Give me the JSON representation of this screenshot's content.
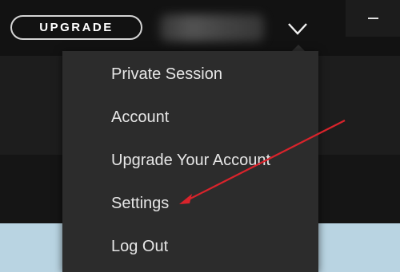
{
  "header": {
    "upgrade_label": "UPGRADE"
  },
  "icons": {
    "profile_menu": "chevron-down-icon",
    "minimize": "minimize-icon"
  },
  "menu": {
    "items": [
      {
        "label": "Private Session"
      },
      {
        "label": "Account"
      },
      {
        "label": "Upgrade Your Account"
      },
      {
        "label": "Settings"
      },
      {
        "label": "Log Out"
      }
    ]
  },
  "annotation": {
    "arrow_color": "#d9232b",
    "points_to": "Settings"
  },
  "colors": {
    "background": "#121212",
    "menu_background": "#2c2c2c",
    "menu_text": "#e6e6e6"
  }
}
